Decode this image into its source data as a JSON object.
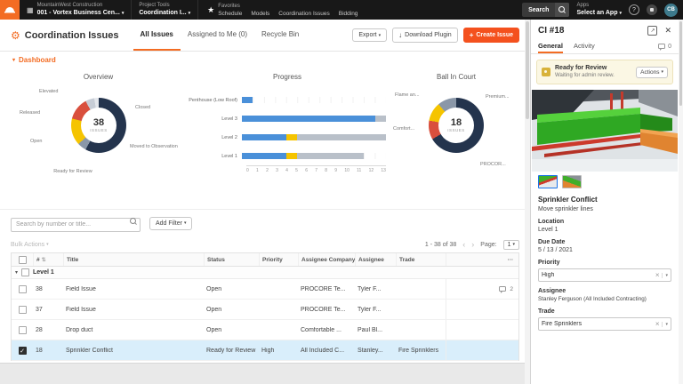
{
  "topbar": {
    "company_name": "MountainWest Construction",
    "company_project": "001 - Vortex Business Cen...",
    "tools_label": "Project Tools",
    "tools_value": "Coordination I...",
    "favorites_label": "Favorites",
    "favorites": [
      "Schedule",
      "Models",
      "Coordination Issues",
      "Bidding"
    ],
    "search_button": "Search",
    "apps_label": "Apps",
    "apps_value": "Select an App",
    "avatar_initials": "CB"
  },
  "header": {
    "title": "Coordination Issues",
    "tabs": [
      {
        "label": "All Issues",
        "active": true
      },
      {
        "label": "Assigned to Me (0)",
        "active": false
      },
      {
        "label": "Recycle Bin",
        "active": false
      }
    ],
    "export_button": "Export",
    "download_button": "Download Plugin",
    "create_button": "Create Issue"
  },
  "dashboard": {
    "toggle_label": "Dashboard"
  },
  "chart_data": [
    {
      "type": "pie",
      "title": "Overview",
      "center_value": "38",
      "center_label": "ISSUES",
      "slices": [
        {
          "label": "Closed",
          "value": 22,
          "color": "#24344d"
        },
        {
          "label": "Moved to Observation",
          "value": 2,
          "color": "#8a97a8"
        },
        {
          "label": "Ready for Review",
          "value": 6,
          "color": "#f5c400"
        },
        {
          "label": "Open",
          "value": 5,
          "color": "#d94f3d"
        },
        {
          "label": "Released",
          "value": 2,
          "color": "#c7cdd6"
        },
        {
          "label": "Elevated",
          "value": 1,
          "color": "#e4e7ec"
        }
      ]
    },
    {
      "type": "bar",
      "title": "Progress",
      "orientation": "horizontal",
      "categories": [
        "Penthouse (Low Roof)",
        "Level 3",
        "Level 2",
        "Level 1"
      ],
      "series": [
        {
          "name": "Open",
          "color": "#4a90d9",
          "values": [
            1,
            12,
            4,
            4
          ]
        },
        {
          "name": "Ready for Review",
          "color": "#f5c400",
          "values": [
            0,
            0,
            1,
            1
          ]
        },
        {
          "name": "Closed",
          "color": "#b9c0c9",
          "values": [
            0,
            1,
            8,
            6
          ]
        }
      ],
      "xlim": [
        0,
        13
      ],
      "x_ticks": [
        0,
        1,
        2,
        3,
        4,
        5,
        6,
        7,
        8,
        9,
        10,
        11,
        12,
        13
      ]
    },
    {
      "type": "pie",
      "title": "Ball In Court",
      "center_value": "18",
      "center_label": "ISSUES",
      "slices": [
        {
          "label": "PROCOR...",
          "value": 12,
          "color": "#24344d"
        },
        {
          "label": "Comfort...",
          "value": 2,
          "color": "#d94f3d"
        },
        {
          "label": "Flame an...",
          "value": 2,
          "color": "#f5c400"
        },
        {
          "label": "Premium...",
          "value": 2,
          "color": "#8a97a8"
        }
      ]
    }
  ],
  "filters": {
    "search_placeholder": "Search by number or title...",
    "add_filter_button": "Add Filter"
  },
  "table_controls": {
    "bulk_actions": "Bulk Actions",
    "range": "1 - 38 of 38",
    "page_label": "Page:",
    "page_value": "1"
  },
  "table": {
    "columns": [
      "#",
      "Title",
      "Status",
      "Priority",
      "Assignee Company",
      "Assignee",
      "Trade"
    ],
    "group_label": "Level 1",
    "rows": [
      {
        "num": "38",
        "title": "Field Issue",
        "status": "Open",
        "priority": "",
        "company": "PROCORE Te...",
        "assignee": "Tyler F...",
        "trade": "",
        "comments": "2",
        "selected": false
      },
      {
        "num": "37",
        "title": "Field Issue",
        "status": "Open",
        "priority": "",
        "company": "PROCORE Te...",
        "assignee": "Tyler F...",
        "trade": "",
        "comments": "",
        "selected": false
      },
      {
        "num": "28",
        "title": "Drop duct",
        "status": "Open",
        "priority": "",
        "company": "Comfortable ...",
        "assignee": "Paul Bl...",
        "trade": "",
        "comments": "",
        "selected": false
      },
      {
        "num": "18",
        "title": "Sprinkler Conflict",
        "status": "Ready for Review",
        "priority": "High",
        "company": "All Included C...",
        "assignee": "Stanley...",
        "trade": "Fire Sprinklers",
        "comments": "",
        "selected": true
      }
    ]
  },
  "panel": {
    "title": "CI #18",
    "tabs": [
      {
        "label": "General",
        "active": true
      },
      {
        "label": "Activity",
        "active": false
      }
    ],
    "comments_count": "0",
    "banner": {
      "status": "Ready for Review",
      "message": "Waiting for admin review.",
      "actions_button": "Actions"
    },
    "issue": {
      "title": "Sprinkler Conflict",
      "description": "Move sprinkler lines",
      "location_label": "Location",
      "location": "Level 1",
      "due_date_label": "Due Date",
      "due_date": "5  /  13  /  2021",
      "priority_label": "Priority",
      "priority": "High",
      "assignee_label": "Assignee",
      "assignee": "Stanley Ferguson (All Included Contracting)",
      "trade_label": "Trade",
      "trade": "Fire Sprinklers"
    }
  },
  "colors": {
    "accent": "#f36c23",
    "create_button": "#f4511e",
    "navy": "#24344d",
    "yellow": "#f5c400",
    "red": "#d94f3d",
    "blue": "#4a90d9",
    "selected_row": "#d9eefb"
  }
}
